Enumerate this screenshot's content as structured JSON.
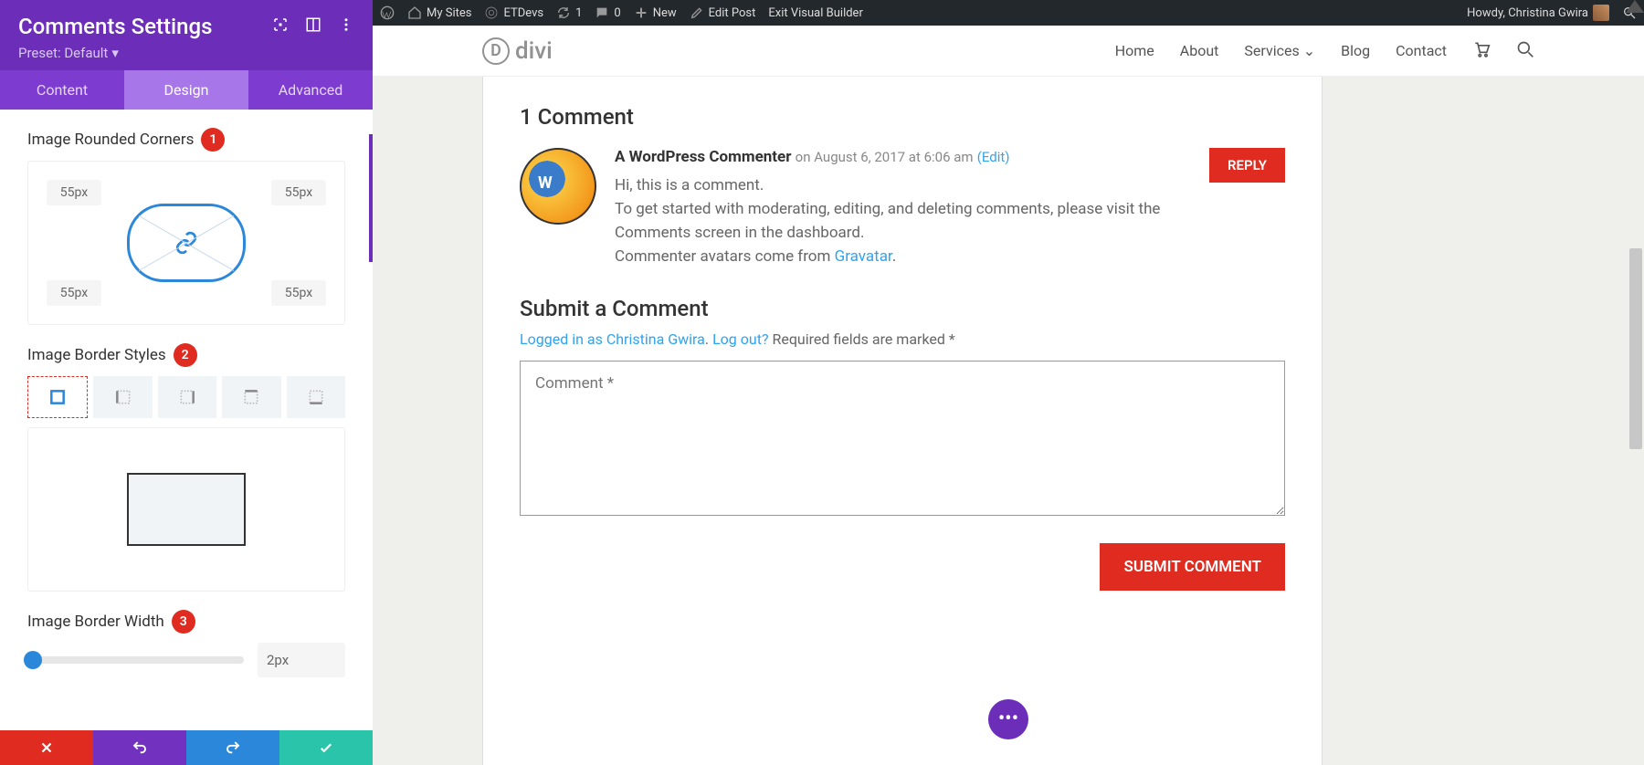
{
  "sidebar": {
    "title": "Comments Settings",
    "preset": "Preset: Default",
    "tabs": {
      "content": "Content",
      "design": "Design",
      "advanced": "Advanced"
    },
    "rounded": {
      "label": "Image Rounded Corners",
      "badge": "1",
      "tl": "55px",
      "tr": "55px",
      "bl": "55px",
      "br": "55px"
    },
    "border_styles": {
      "label": "Image Border Styles",
      "badge": "2"
    },
    "border_width": {
      "label": "Image Border Width",
      "badge": "3",
      "value": "2px"
    }
  },
  "adminbar": {
    "my_sites": "My Sites",
    "site": "ETDevs",
    "update_count": "1",
    "comment_count": "0",
    "new": "New",
    "edit": "Edit Post",
    "exit": "Exit Visual Builder",
    "howdy": "Howdy, Christina Gwira"
  },
  "site": {
    "logo": "divi",
    "nav": {
      "home": "Home",
      "about": "About",
      "services": "Services",
      "blog": "Blog",
      "contact": "Contact"
    }
  },
  "comments": {
    "count_label": "1 Comment",
    "author": "A WordPress Commenter",
    "date": "on August 6, 2017 at 6:06 am",
    "edit": "(Edit)",
    "l1": "Hi, this is a comment.",
    "l2": "To get started with moderating, editing, and deleting comments, please visit the Comments screen in the dashboard.",
    "l3a": "Commenter avatars come from ",
    "l3b": "Gravatar",
    "l3c": ".",
    "reply": "REPLY"
  },
  "form": {
    "title": "Submit a Comment",
    "logged_in": "Logged in as Christina Gwira",
    "logout": "Log out?",
    "required": " Required fields are marked *",
    "placeholder": "Comment *",
    "submit": "SUBMIT COMMENT"
  }
}
